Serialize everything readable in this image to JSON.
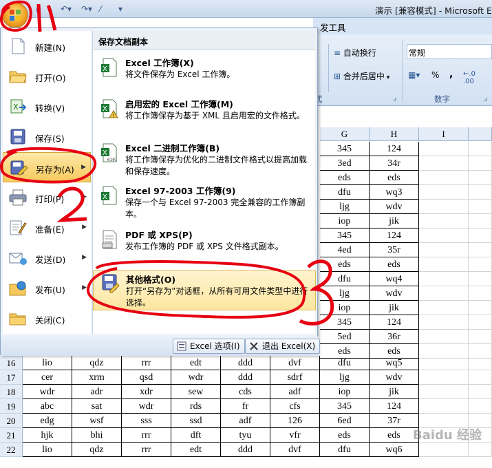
{
  "title_bar": {
    "title": "演示 [兼容模式] - Microsoft E"
  },
  "ribbon": {
    "tab_label": "发工具",
    "wrap_text": "自动换行",
    "merge_center": "合并后居中",
    "number_format": "常规",
    "percent": "%",
    "comma": ",",
    "group_alignment_tail": "式",
    "group_number": "数字"
  },
  "columns": [
    {
      "label": "G"
    },
    {
      "label": "H"
    },
    {
      "label": "I"
    }
  ],
  "visible_right_rows": [
    {
      "g": "345",
      "h": "124"
    },
    {
      "g": "3ed",
      "h": "34r"
    },
    {
      "g": "eds",
      "h": "eds"
    },
    {
      "g": "dfu",
      "h": "wq3"
    },
    {
      "g": "ljg",
      "h": "wdv"
    },
    {
      "g": "iop",
      "h": "jik"
    },
    {
      "g": "345",
      "h": "124"
    },
    {
      "g": "4ed",
      "h": "35r"
    },
    {
      "g": "eds",
      "h": "eds"
    },
    {
      "g": "dfu",
      "h": "wq4"
    },
    {
      "g": "ljg",
      "h": "wdv"
    },
    {
      "g": "iop",
      "h": "jik"
    },
    {
      "g": "345",
      "h": "124"
    },
    {
      "g": "5ed",
      "h": "36r"
    },
    {
      "g": "eds",
      "h": "eds"
    }
  ],
  "full_rows": [
    {
      "num": "16",
      "cells": [
        "lio",
        "qdz",
        "rrr",
        "edt",
        "ddd",
        "dvf",
        "dfu",
        "wq5"
      ]
    },
    {
      "num": "17",
      "cells": [
        "cer",
        "xrm",
        "qsd",
        "wdr",
        "ddd",
        "sdrf",
        "ljg",
        "wdv"
      ]
    },
    {
      "num": "18",
      "cells": [
        "wdr",
        "adr",
        "xdr",
        "sew",
        "cds",
        "adf",
        "iop",
        "jik"
      ]
    },
    {
      "num": "19",
      "cells": [
        "abc",
        "sat",
        "wdr",
        "rds",
        "fr",
        "cfs",
        "345",
        "124"
      ]
    },
    {
      "num": "20",
      "cells": [
        "edg",
        "wsf",
        "sss",
        "ssd",
        "adf",
        "126",
        "6ed",
        "37r"
      ]
    },
    {
      "num": "21",
      "cells": [
        "hjk",
        "bhi",
        "rrr",
        "dft",
        "tyu",
        "vfr",
        "eds",
        "eds"
      ]
    },
    {
      "num": "22",
      "cells": [
        "lio",
        "qdz",
        "rrr",
        "edt",
        "ddd",
        "dvf",
        "dfu",
        "wq6"
      ]
    }
  ],
  "office_menu": {
    "left_items": [
      {
        "label": "新建(N)",
        "icon": "new-document-icon",
        "arrow": ""
      },
      {
        "label": "打开(O)",
        "icon": "open-folder-icon",
        "arrow": ""
      },
      {
        "label": "转换(V)",
        "icon": "convert-icon",
        "arrow": ""
      },
      {
        "label": "保存(S)",
        "icon": "save-disk-icon",
        "arrow": ""
      },
      {
        "label": "另存为(A)",
        "icon": "save-as-icon",
        "arrow": "▶"
      },
      {
        "label": "打印(P)",
        "icon": "printer-icon",
        "arrow": "▶"
      },
      {
        "label": "准备(E)",
        "icon": "prepare-icon",
        "arrow": "▶"
      },
      {
        "label": "发送(D)",
        "icon": "send-icon",
        "arrow": "▶"
      },
      {
        "label": "发布(U)",
        "icon": "publish-icon",
        "arrow": "▶"
      },
      {
        "label": "关闭(C)",
        "icon": "close-folder-icon",
        "arrow": ""
      }
    ],
    "right_header": "保存文档副本",
    "right_items": [
      {
        "title": "Excel 工作簿(X)",
        "desc": "将文件保存为 Excel 工作簿。",
        "icon": "excel-workbook-icon"
      },
      {
        "title": "启用宏的 Excel 工作簿(M)",
        "desc": "将工作簿保存为基于 XML 且启用宏的文件格式。",
        "icon": "excel-macro-icon"
      },
      {
        "title": "Excel 二进制工作簿(B)",
        "desc": "将工作簿保存为优化的二进制文件格式以提高加载和保存速度。",
        "icon": "excel-binary-icon"
      },
      {
        "title": "Excel 97-2003 工作簿(9)",
        "desc": "保存一个与 Excel 97-2003 完全兼容的工作簿副本。",
        "icon": "excel-97-icon"
      },
      {
        "title": "PDF 或 XPS(P)",
        "desc": "发布工作簿的 PDF 或 XPS 文件格式副本。",
        "icon": "pdf-xps-icon"
      },
      {
        "title": "其他格式(O)",
        "desc": "打开“另存为”对话框，从所有可用文件类型中进行选择。",
        "icon": "other-formats-icon"
      }
    ],
    "footer": {
      "options": "Excel 选项(I)",
      "exit": "退出 Excel(X)"
    }
  },
  "annotations": [
    "1",
    "2",
    "3"
  ],
  "watermark": "Baidu 经验",
  "colors": {
    "accent": "#e60012",
    "menu_highlight": "#f7c95d",
    "ribbon": "#d2e1f3"
  }
}
